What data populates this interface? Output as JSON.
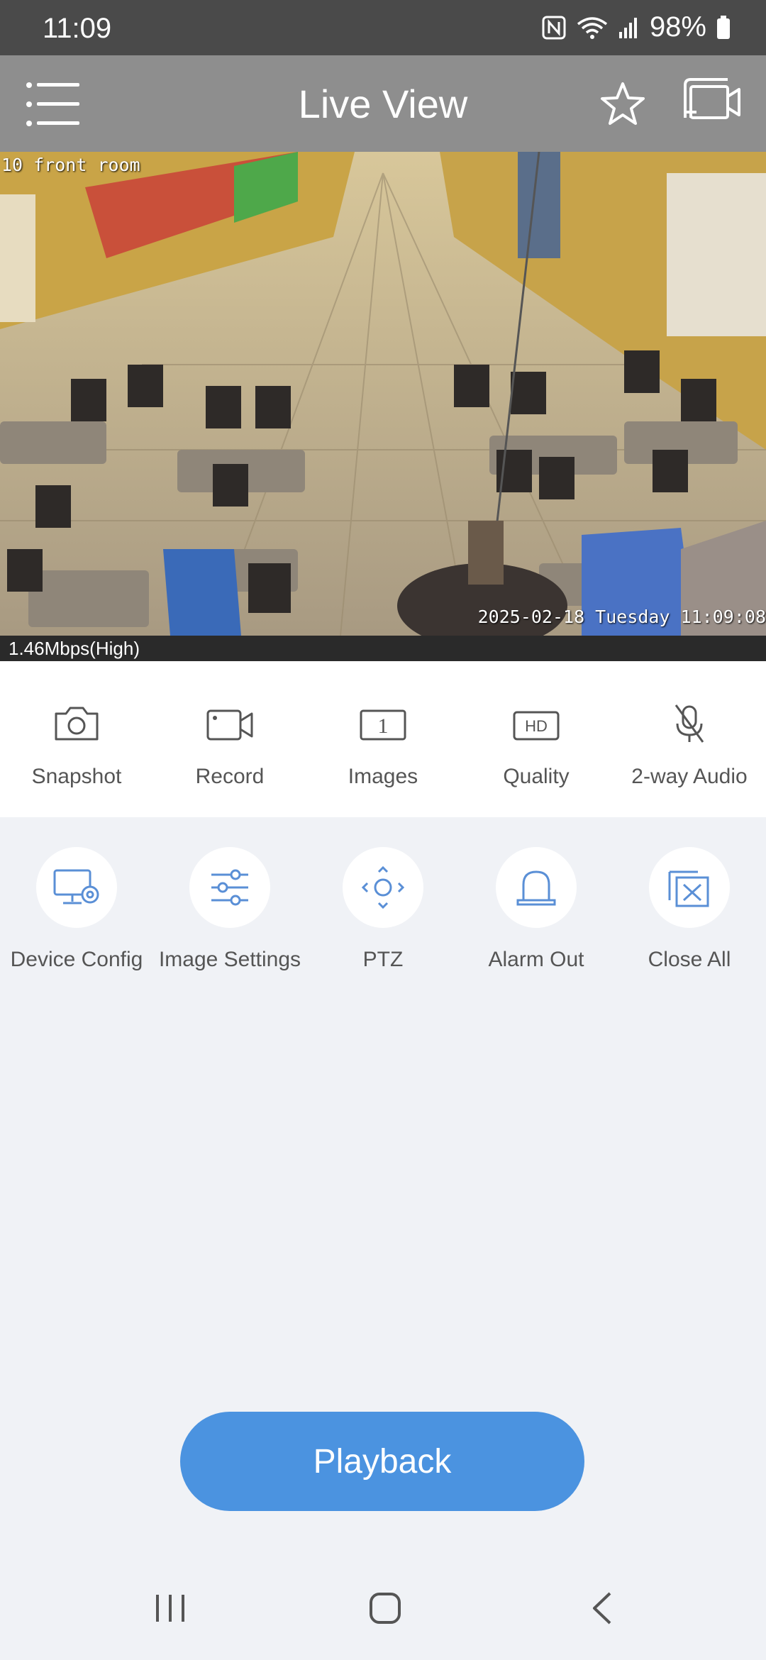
{
  "status_bar": {
    "time": "11:09",
    "battery": "98%"
  },
  "app_bar": {
    "title": "Live View"
  },
  "video": {
    "camera_label": "10 front room",
    "timestamp": "2025-02-18 Tuesday 11:09:08",
    "bitrate": "1.46Mbps(High)"
  },
  "toolbar": {
    "snapshot": "Snapshot",
    "record": "Record",
    "images": "Images",
    "images_badge": "1",
    "quality": "Quality",
    "quality_badge": "HD",
    "audio": "2-way Audio"
  },
  "quick_actions": {
    "device_config": "Device Config",
    "image_settings": "Image Settings",
    "ptz": "PTZ",
    "alarm_out": "Alarm Out",
    "close_all": "Close All"
  },
  "playback": {
    "label": "Playback"
  },
  "colors": {
    "accent": "#4b93e0",
    "icon_blue": "#5a8fd6",
    "header": "#8e8e8e"
  }
}
